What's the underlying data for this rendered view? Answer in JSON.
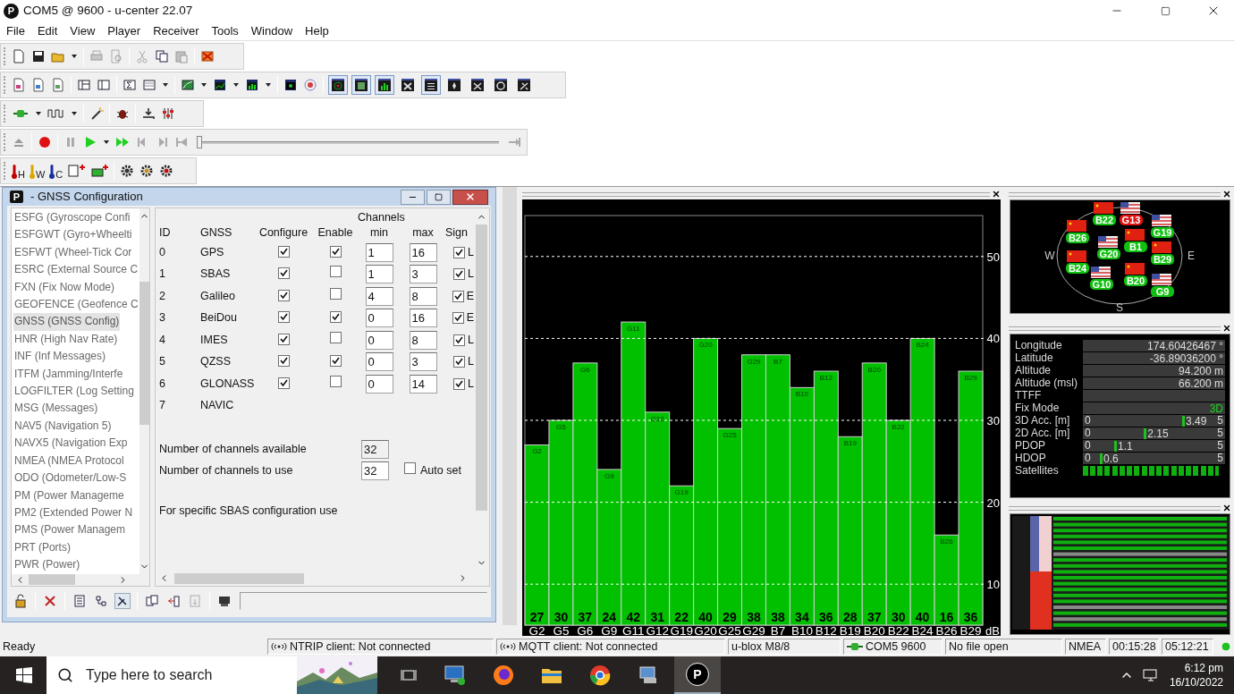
{
  "window": {
    "logo": "P",
    "title": "COM5 @ 9600 - u-center 22.07"
  },
  "menu": [
    "File",
    "Edit",
    "View",
    "Player",
    "Receiver",
    "Tools",
    "Window",
    "Help"
  ],
  "view_toggles": [
    {
      "pressed": true
    },
    {
      "pressed": true
    },
    {
      "pressed": true
    },
    {
      "pressed": false
    },
    {
      "pressed": true
    },
    {
      "pressed": false
    },
    {
      "pressed": false
    },
    {
      "pressed": false
    },
    {
      "pressed": false
    }
  ],
  "player": {
    "level": 0
  },
  "sensor_buttons": [
    {
      "label": "H",
      "color": "#c00000"
    },
    {
      "label": "W",
      "color": "#d8a800"
    },
    {
      "label": "C",
      "color": "#1830a0"
    }
  ],
  "gnss_config": {
    "logo": "P",
    "title": "- GNSS Configuration",
    "messages": [
      {
        "label": "ESFG (Gyroscope Confi",
        "selected": false
      },
      {
        "label": "ESFGWT (Gyro+Wheelti",
        "selected": false
      },
      {
        "label": "ESFWT (Wheel-Tick Cor",
        "selected": false
      },
      {
        "label": "ESRC (External Source C",
        "selected": false
      },
      {
        "label": "FXN (Fix Now Mode)",
        "selected": false
      },
      {
        "label": "GEOFENCE (Geofence C",
        "selected": false
      },
      {
        "label": "GNSS (GNSS Config)",
        "selected": true
      },
      {
        "label": "HNR (High Nav Rate)",
        "selected": false
      },
      {
        "label": "INF (Inf Messages)",
        "selected": false
      },
      {
        "label": "ITFM (Jamming/Interfe",
        "selected": false
      },
      {
        "label": "LOGFILTER (Log Setting",
        "selected": false
      },
      {
        "label": "MSG (Messages)",
        "selected": false
      },
      {
        "label": "NAV5 (Navigation 5)",
        "selected": false
      },
      {
        "label": "NAVX5 (Navigation Exp",
        "selected": false
      },
      {
        "label": "NMEA (NMEA Protocol",
        "selected": false
      },
      {
        "label": "ODO (Odometer/Low-S",
        "selected": false
      },
      {
        "label": "PM (Power Manageme",
        "selected": false
      },
      {
        "label": "PM2 (Extended Power N",
        "selected": false
      },
      {
        "label": "PMS (Power Managem",
        "selected": false
      },
      {
        "label": "PRT (Ports)",
        "selected": false
      },
      {
        "label": "PWR (Power)",
        "selected": false
      }
    ],
    "channels_heading": "Channels",
    "columns": [
      "ID",
      "GNSS",
      "Configure",
      "Enable",
      "min",
      "max",
      "Sign"
    ],
    "rows": [
      {
        "kind": "full",
        "id": "0",
        "gnss": "GPS",
        "configure": true,
        "enable": true,
        "min": "1",
        "max": "16",
        "signal_checked": true,
        "signal": "L"
      },
      {
        "kind": "full",
        "id": "1",
        "gnss": "SBAS",
        "configure": true,
        "enable": false,
        "min": "1",
        "max": "3",
        "signal_checked": true,
        "signal": "L"
      },
      {
        "kind": "full",
        "id": "2",
        "gnss": "Galileo",
        "configure": true,
        "enable": false,
        "min": "4",
        "max": "8",
        "signal_checked": true,
        "signal": "E"
      },
      {
        "kind": "full",
        "id": "3",
        "gnss": "BeiDou",
        "configure": true,
        "enable": true,
        "min": "0",
        "max": "16",
        "signal_checked": true,
        "signal": "E"
      },
      {
        "kind": "full",
        "id": "4",
        "gnss": "IMES",
        "configure": true,
        "enable": false,
        "min": "0",
        "max": "8",
        "signal_checked": true,
        "signal": "L"
      },
      {
        "kind": "full",
        "id": "5",
        "gnss": "QZSS",
        "configure": true,
        "enable": true,
        "min": "0",
        "max": "3",
        "signal_checked": true,
        "signal": "L"
      },
      {
        "kind": "full",
        "id": "6",
        "gnss": "GLONASS",
        "configure": true,
        "enable": false,
        "min": "0",
        "max": "14",
        "signal_checked": true,
        "signal": "L"
      },
      {
        "kind": "name_only",
        "id": "7",
        "gnss": "NAVIC"
      }
    ],
    "available": {
      "label": "Number of channels available",
      "value": "32"
    },
    "to_use": {
      "label": "Number of channels to use",
      "value": "32"
    },
    "auto_set": {
      "label": "Auto set",
      "checked": false
    },
    "note": "For specific SBAS configuration use"
  },
  "signal_chart": {
    "unit": "dB",
    "chart_data": {
      "type": "bar",
      "categories": [
        "G2",
        "G5",
        "G6",
        "G9",
        "G11",
        "G12",
        "G19",
        "G20",
        "G25",
        "G29",
        "B7",
        "B10",
        "B12",
        "B19",
        "B20",
        "B22",
        "B24",
        "B26",
        "B29"
      ],
      "values": [
        27,
        30,
        37,
        24,
        42,
        31,
        22,
        40,
        29,
        38,
        38,
        34,
        36,
        28,
        37,
        30,
        40,
        16,
        36
      ],
      "ylim": [
        5,
        55
      ],
      "yticks": [
        10,
        20,
        30,
        40,
        50
      ],
      "grid": true,
      "data_labels": true
    }
  },
  "sky_view": {
    "compass": [
      "W",
      "E",
      "S"
    ],
    "satellites": [
      {
        "label": "G13",
        "kind": "us",
        "color": "#e01010"
      },
      {
        "label": "B22",
        "kind": "cn",
        "color": "#10c010"
      },
      {
        "label": "B26",
        "kind": "cn",
        "color": "#10c010"
      },
      {
        "label": "G19",
        "kind": "us",
        "color": "#10c010"
      },
      {
        "label": "B1",
        "kind": "cn",
        "color": "#10c010"
      },
      {
        "label": "B29",
        "kind": "cn",
        "color": "#10c010"
      },
      {
        "label": "G20",
        "kind": "us",
        "color": "#10c010"
      },
      {
        "label": "B24",
        "kind": "cn",
        "color": "#10c010"
      },
      {
        "label": "G10",
        "kind": "us",
        "color": "#10c010"
      },
      {
        "label": "B20",
        "kind": "cn",
        "color": "#10c010"
      },
      {
        "label": "G9",
        "kind": "us",
        "color": "#10c010"
      }
    ]
  },
  "navigation": [
    {
      "kind": "value",
      "label": "Longitude",
      "value": "174.60426467 °"
    },
    {
      "kind": "value",
      "label": "Latitude",
      "value": "-36.89036200 °"
    },
    {
      "kind": "value",
      "label": "Altitude",
      "value": "94.200 m"
    },
    {
      "kind": "value",
      "label": "Altitude (msl)",
      "value": "66.200 m"
    },
    {
      "kind": "value",
      "label": "TTFF"
    },
    {
      "kind": "fix",
      "label": "Fix Mode",
      "value": "3D"
    },
    {
      "kind": "meter",
      "label": "3D Acc. [m]",
      "min": "0",
      "reading": "3.49",
      "max": "5",
      "level": 0.698
    },
    {
      "kind": "meter",
      "label": "2D Acc. [m]",
      "min": "0",
      "reading": "2.15",
      "max": "5",
      "level": 0.43
    },
    {
      "kind": "meter",
      "label": "PDOP",
      "min": "0",
      "reading": "1.1",
      "max": "5",
      "level": 0.22
    },
    {
      "kind": "meter",
      "label": "HDOP",
      "min": "0",
      "reading": "0.6",
      "max": "5",
      "level": 0.12
    },
    {
      "kind": "blocks",
      "label": "Satellites"
    }
  ],
  "status_bar": [
    {
      "kind": "text",
      "label": "Ready"
    },
    {
      "kind": "network",
      "label": "NTRIP client: Not connected"
    },
    {
      "kind": "network",
      "label": "MQTT client: Not connected"
    },
    {
      "kind": "text",
      "label": "u-blox M8/8"
    },
    {
      "kind": "serial",
      "label": "COM5 9600"
    },
    {
      "kind": "text",
      "label": "No file open"
    },
    {
      "kind": "text",
      "label": "NMEA"
    },
    {
      "kind": "text",
      "label": "00:15:28"
    },
    {
      "kind": "text",
      "label": "05:12:21"
    }
  ],
  "taskbar": {
    "search_placeholder": "Type here to search",
    "active_app_logo": "P",
    "time": "6:12 pm",
    "date": "16/10/2022"
  }
}
